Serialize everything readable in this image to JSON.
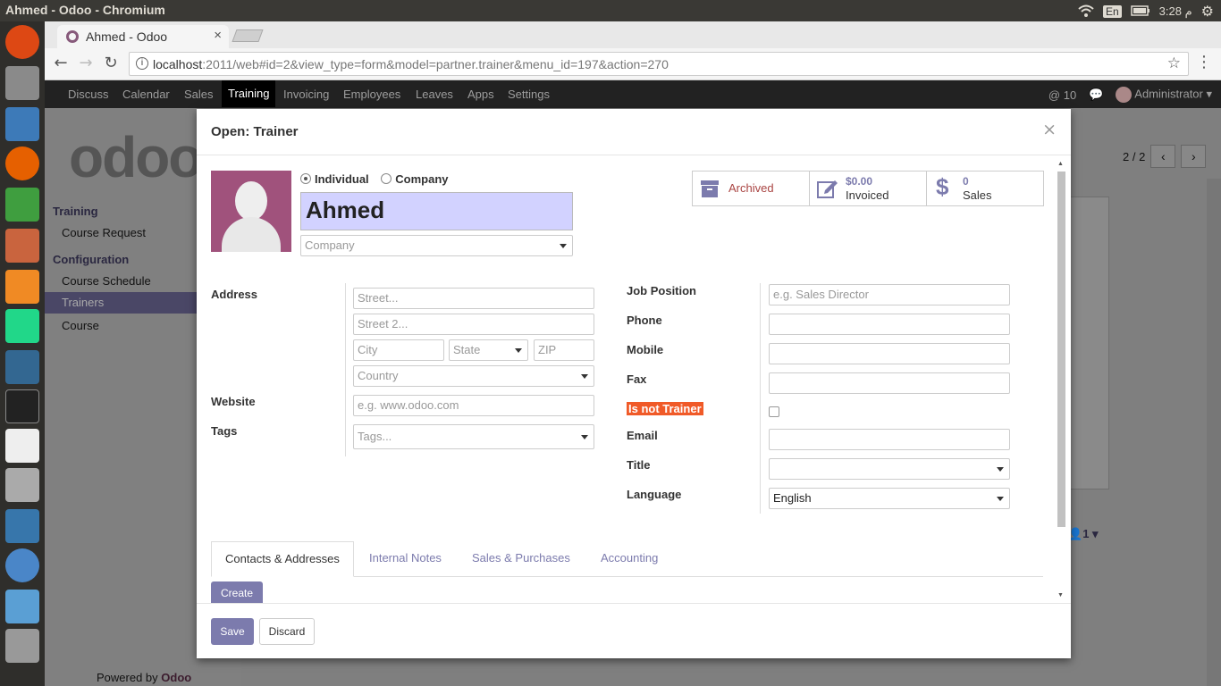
{
  "os": {
    "window_title": "Ahmed - Odoo - Chromium",
    "keyboard": "En",
    "clock": "3:28 م"
  },
  "browser": {
    "tab_title": "Ahmed - Odoo",
    "url_host": "localhost",
    "url_rest": ":2011/web#id=2&view_type=form&model=partner.trainer&menu_id=197&action=270"
  },
  "appnav": {
    "items": [
      "Discuss",
      "Calendar",
      "Sales",
      "Training",
      "Invoicing",
      "Employees",
      "Leaves",
      "Apps",
      "Settings"
    ],
    "active": "Training",
    "notif_count": "@ 10",
    "user": "Administrator"
  },
  "sidebar": {
    "logo": "odoo",
    "section1": "Training",
    "item1": "Course Request",
    "section2": "Configuration",
    "item2": "Course Schedule",
    "item3": "Trainers",
    "item4": "Course",
    "powered_prefix": "Powered by ",
    "powered_brand": "Odoo"
  },
  "pager": {
    "value": "2 / 2",
    "followers": "1"
  },
  "modal": {
    "title": "Open: Trainer",
    "close": "×",
    "type_individual": "Individual",
    "type_company": "Company",
    "name": "Ahmed",
    "company_placeholder": "Company",
    "stats": {
      "archived": "Archived",
      "invoiced_value": "$0.00",
      "invoiced_label": "Invoiced",
      "sales_value": "0",
      "sales_label": "Sales"
    },
    "left": {
      "address_label": "Address",
      "street_ph": "Street...",
      "street2_ph": "Street 2...",
      "city_ph": "City",
      "state_ph": "State",
      "zip_ph": "ZIP",
      "country_ph": "Country",
      "website_label": "Website",
      "website_ph": "e.g. www.odoo.com",
      "tags_label": "Tags",
      "tags_ph": "Tags..."
    },
    "right": {
      "job_label": "Job Position",
      "job_ph": "e.g. Sales Director",
      "phone_label": "Phone",
      "mobile_label": "Mobile",
      "fax_label": "Fax",
      "trainer_label": "Is not Trainer",
      "email_label": "Email",
      "title_label": "Title",
      "language_label": "Language",
      "language_value": "English"
    },
    "tabs": [
      "Contacts & Addresses",
      "Internal Notes",
      "Sales & Purchases",
      "Accounting"
    ],
    "create": "Create",
    "save": "Save",
    "discard": "Discard"
  },
  "colors": {
    "odoo_purple": "#7c7bad",
    "trainer_highlight": "#f05a28",
    "name_bg": "#d2d2ff"
  }
}
